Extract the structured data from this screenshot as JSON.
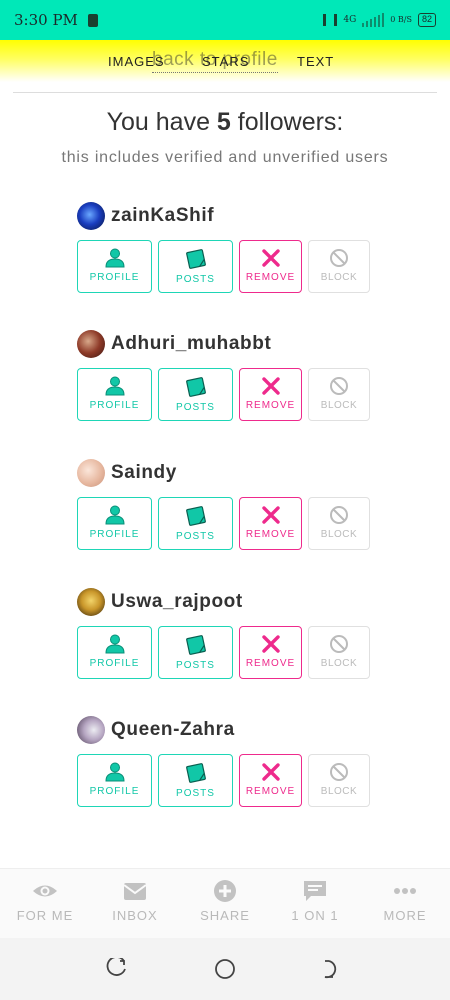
{
  "status_bar": {
    "time": "3:30 PM",
    "network": "4G",
    "speed": "0 B/S",
    "battery": "82"
  },
  "tabs": {
    "images": "IMAGES",
    "stars": "STARS",
    "text": "TEXT",
    "overlay": "back to profile"
  },
  "summary": {
    "prefix": "You have ",
    "count": "5",
    "suffix": " followers:",
    "subtitle": "this includes verified and unverified users"
  },
  "action_labels": {
    "profile": "PROFILE",
    "posts": "POSTS",
    "remove": "REMOVE",
    "block": "BLOCK"
  },
  "colors": {
    "accent": "#00e8b8",
    "teal": "#11c7a7",
    "remove": "#ee2a8c",
    "disabled": "#bbbbbb"
  },
  "followers": [
    {
      "username": "zainKaShif"
    },
    {
      "username": "Adhuri_muhabbt"
    },
    {
      "username": "Saindy"
    },
    {
      "username": "Uswa_rajpoot"
    },
    {
      "username": "Queen-Zahra"
    }
  ],
  "bottom_nav": {
    "items": [
      {
        "label": "FOR ME",
        "icon": "eye-icon"
      },
      {
        "label": "INBOX",
        "icon": "envelope-icon"
      },
      {
        "label": "SHARE",
        "icon": "plus-circle-icon"
      },
      {
        "label": "1 ON 1",
        "icon": "chat-icon"
      },
      {
        "label": "MORE",
        "icon": "more-dots-icon"
      }
    ]
  },
  "system_nav": {
    "items": [
      "recents-icon",
      "home-icon",
      "back-icon"
    ]
  }
}
